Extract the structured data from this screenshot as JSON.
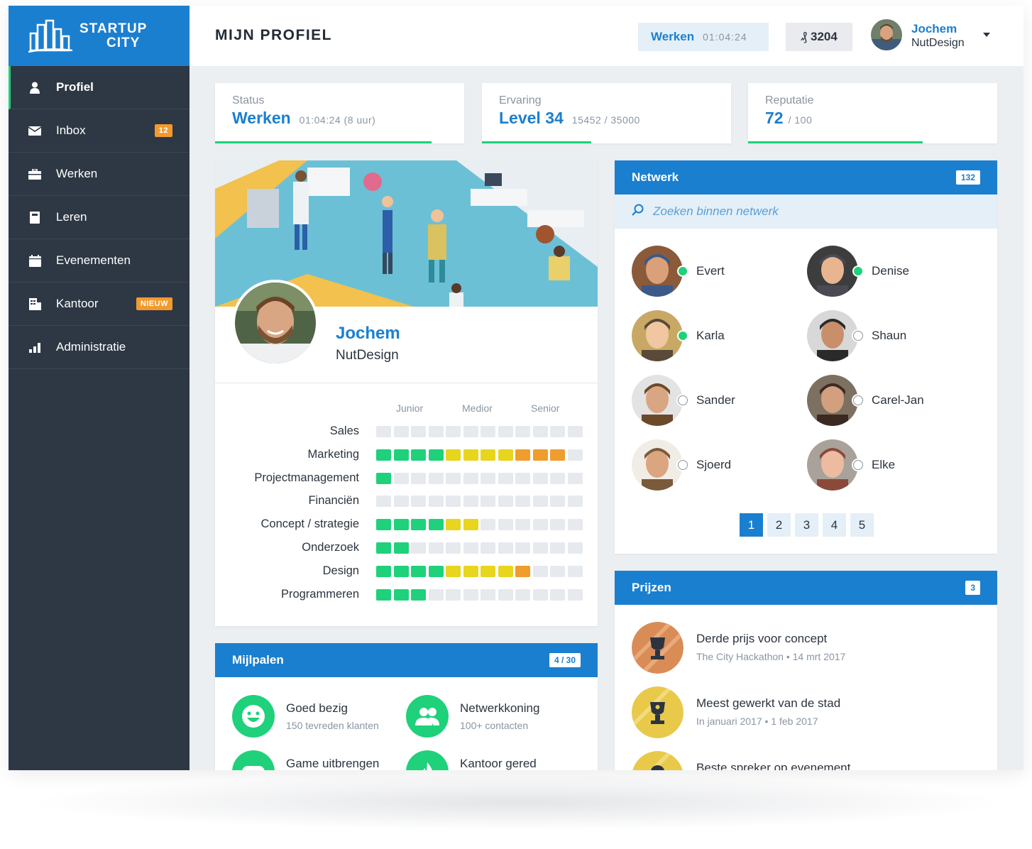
{
  "brand": {
    "line1": "STARTUP",
    "line2": "CITY"
  },
  "colors": {
    "primary": "#1b7fd0",
    "success": "#1fd17a",
    "warning": "#f39a2e",
    "sidebar": "#2e3844"
  },
  "sidebar": {
    "items": [
      {
        "label": "Profiel",
        "icon": "user-icon",
        "active": true
      },
      {
        "label": "Inbox",
        "icon": "mail-icon",
        "badge": "12"
      },
      {
        "label": "Werken",
        "icon": "briefcase-icon"
      },
      {
        "label": "Leren",
        "icon": "book-icon"
      },
      {
        "label": "Evenementen",
        "icon": "calendar-icon"
      },
      {
        "label": "Kantoor",
        "icon": "building-icon",
        "badge": "NIEUW"
      },
      {
        "label": "Administratie",
        "icon": "bar-chart-icon"
      }
    ]
  },
  "header": {
    "title": "MIJN PROFIEL",
    "work_label": "Werken",
    "work_timer": "01:04:24",
    "coins": "3204",
    "user_name": "Jochem",
    "user_company": "NutDesign"
  },
  "stats": {
    "status": {
      "label": "Status",
      "value": "Werken",
      "detail": "01:04:24  (8 uur)",
      "progress": 0.87
    },
    "experience": {
      "label": "Ervaring",
      "value": "Level 34",
      "detail": "15452 / 35000",
      "progress": 0.44
    },
    "reputation": {
      "label": "Reputatie",
      "value": "72",
      "detail": "/ 100",
      "progress": 0.7
    }
  },
  "profile": {
    "name": "Jochem",
    "company": "NutDesign",
    "levels": [
      "Junior",
      "Medior",
      "Senior"
    ],
    "skills": [
      {
        "name": "Sales",
        "levels": "000000000000"
      },
      {
        "name": "Marketing",
        "levels": "ggggyyyyooo0"
      },
      {
        "name": "Projectmanagement",
        "levels": "g00000000000"
      },
      {
        "name": "Financiën",
        "levels": "000000000000"
      },
      {
        "name": "Concept / strategie",
        "levels": "ggggyy000000"
      },
      {
        "name": "Onderzoek",
        "levels": "gg0000000000"
      },
      {
        "name": "Design",
        "levels": "ggggyyyyo000"
      },
      {
        "name": "Programmeren",
        "levels": "ggg000000000"
      }
    ]
  },
  "milestones": {
    "title": "Mijlpalen",
    "count": "4 / 30",
    "items": [
      {
        "title": "Goed bezig",
        "sub": "150 tevreden klanten",
        "icon": "smiley-icon"
      },
      {
        "title": "Netwerkkoning",
        "sub": "100+ contacten",
        "icon": "people-icon"
      },
      {
        "title": "Game uitbrengen",
        "sub": "",
        "icon": "gamepad-icon"
      },
      {
        "title": "Kantoor gered",
        "sub": "",
        "icon": "flame-icon"
      }
    ]
  },
  "network": {
    "title": "Netwerk",
    "count": "132",
    "search_placeholder": "Zoeken binnen netwerk",
    "contacts": [
      {
        "name": "Evert",
        "online": true
      },
      {
        "name": "Denise",
        "online": true
      },
      {
        "name": "Karla",
        "online": true
      },
      {
        "name": "Shaun",
        "online": false
      },
      {
        "name": "Sander",
        "online": false
      },
      {
        "name": "Carel-Jan",
        "online": false
      },
      {
        "name": "Sjoerd",
        "online": false
      },
      {
        "name": "Elke",
        "online": false
      }
    ],
    "pages": [
      "1",
      "2",
      "3",
      "4",
      "5"
    ],
    "current_page": "1"
  },
  "prizes": {
    "title": "Prijzen",
    "count": "3",
    "items": [
      {
        "title": "Derde prijs voor concept",
        "sub": "The City Hackathon • 14 mrt 2017",
        "color": "#d98c56",
        "icon": "trophy-icon"
      },
      {
        "title": "Meest gewerkt van de stad",
        "sub": "In januari 2017 • 1 feb 2017",
        "color": "#e8c94a",
        "icon": "trophy-icon"
      },
      {
        "title": "Beste spreker op evenement",
        "sub": "",
        "color": "#e8c94a",
        "icon": "medal-icon"
      }
    ]
  }
}
